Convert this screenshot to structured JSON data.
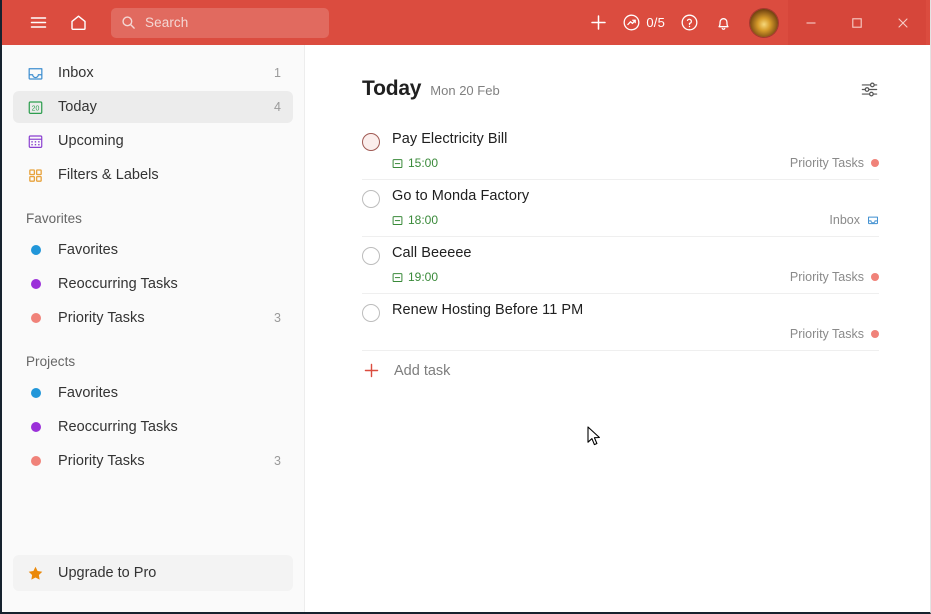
{
  "window": {
    "controls": {
      "minimize": "minimize-icon",
      "maximize": "maximize-icon",
      "close": "close-icon"
    }
  },
  "topbar": {
    "background": "#db4c3f",
    "menu_icon": "hamburger-menu-icon",
    "home_icon": "home-icon",
    "search": {
      "placeholder": "Search",
      "icon": "search-icon"
    },
    "add_icon": "plus-icon",
    "productivity": {
      "icon": "productivity-trend-icon",
      "count": "0/5"
    },
    "help_icon": "question-mark-icon",
    "notifications_icon": "bell-icon",
    "avatar": "user-avatar"
  },
  "sidebar": {
    "nav": [
      {
        "label": "Inbox",
        "count": "1",
        "icon": "inbox-tray-icon",
        "active": false
      },
      {
        "label": "Today",
        "count": "4",
        "icon": "today-calendar-icon",
        "active": true
      },
      {
        "label": "Upcoming",
        "count": "",
        "icon": "upcoming-calendar-icon",
        "active": false
      },
      {
        "label": "Filters & Labels",
        "count": "",
        "icon": "filters-labels-icon",
        "active": false
      }
    ],
    "favorites": {
      "title": "Favorites",
      "items": [
        {
          "label": "Favorites",
          "count": "",
          "color": "#2196d9"
        },
        {
          "label": "Reoccurring Tasks",
          "count": "",
          "color": "#9b30d9"
        },
        {
          "label": "Priority Tasks",
          "count": "3",
          "color": "#f08279"
        }
      ]
    },
    "projects": {
      "title": "Projects",
      "items": [
        {
          "label": "Favorites",
          "count": "",
          "color": "#2196d9"
        },
        {
          "label": "Reoccurring Tasks",
          "count": "",
          "color": "#9b30d9"
        },
        {
          "label": "Priority Tasks",
          "count": "3",
          "color": "#f08279"
        }
      ]
    },
    "upgrade": {
      "label": "Upgrade to Pro",
      "icon": "star-icon",
      "color": "#eb8909"
    }
  },
  "main": {
    "title": "Today",
    "date": "Mon 20 Feb",
    "view_options_icon": "sliders-icon",
    "tasks": [
      {
        "title": "Pay Electricity Bill",
        "time": "15:00",
        "time_icon": "calendar-event-icon",
        "project": "Priority Tasks",
        "project_color": "#f08279",
        "project_icon": "dot",
        "checkbox_hovered": true
      },
      {
        "title": "Go to Monda Factory",
        "time": "18:00",
        "time_icon": "calendar-event-icon",
        "project": "Inbox",
        "project_color": "#2196d9",
        "project_icon": "inbox-tray-icon",
        "checkbox_hovered": false
      },
      {
        "title": "Call Beeeee",
        "time": "19:00",
        "time_icon": "calendar-event-icon",
        "project": "Priority Tasks",
        "project_color": "#f08279",
        "project_icon": "dot",
        "checkbox_hovered": false
      },
      {
        "title": "Renew Hosting Before 11 PM",
        "time": "",
        "time_icon": "",
        "project": "Priority Tasks",
        "project_color": "#f08279",
        "project_icon": "dot",
        "checkbox_hovered": false
      }
    ],
    "add_task": {
      "label": "Add task",
      "icon": "plus-icon",
      "color": "#db4c3f"
    }
  }
}
